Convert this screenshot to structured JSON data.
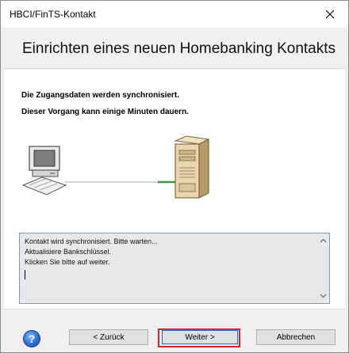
{
  "window": {
    "title": "HBCI/FinTS-Kontakt"
  },
  "header": {
    "heading": "Einrichten eines neuen Homebanking Kontakts"
  },
  "content": {
    "message_line1": "Die Zugangsdaten werden synchronisiert.",
    "message_line2": "Dieser Vorgang kann einige Minuten dauern.",
    "log_lines": [
      "Kontakt wird synchronisiert. Bitte warten...",
      "Aktualisiere Bankschlüssel.",
      "Klicken Sie bitte auf weiter."
    ]
  },
  "footer": {
    "help_icon": "help-icon",
    "back_label": "< Zurück",
    "next_label": "Weiter >",
    "cancel_label": "Abbrechen"
  },
  "colors": {
    "accent_focus": "#0078d7",
    "highlight_box": "#e2202a",
    "connection_line": "#2e9b3e"
  }
}
